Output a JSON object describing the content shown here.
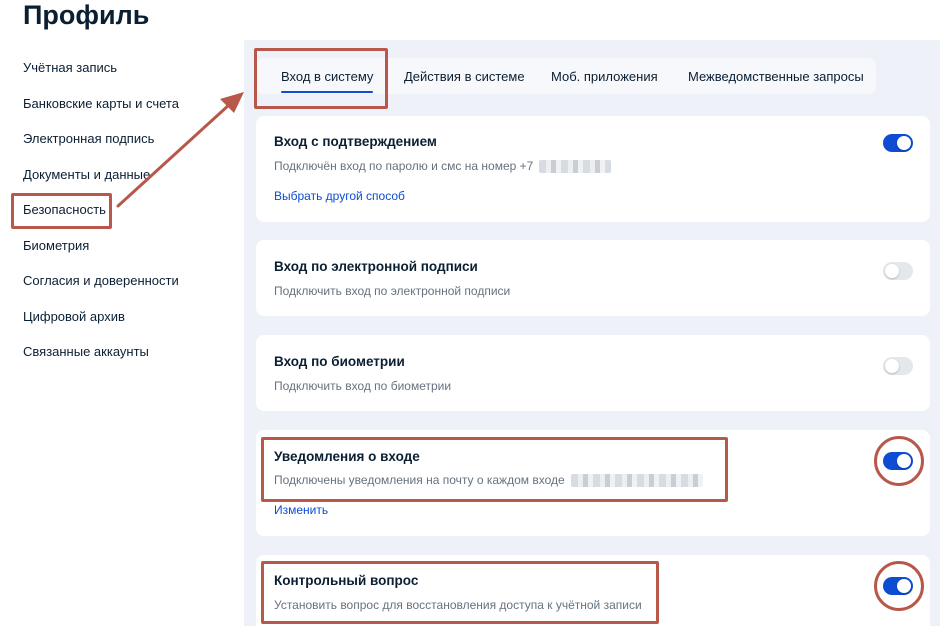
{
  "page": {
    "title": "Профиль"
  },
  "sidebar": {
    "items": [
      {
        "label": "Учётная запись"
      },
      {
        "label": "Банковские карты и счета"
      },
      {
        "label": "Электронная подпись"
      },
      {
        "label": "Документы и данные"
      },
      {
        "label": "Безопасность",
        "selected": true
      },
      {
        "label": "Биометрия"
      },
      {
        "label": "Согласия и доверенности"
      },
      {
        "label": "Цифровой архив"
      },
      {
        "label": "Связанные аккаунты"
      }
    ]
  },
  "tabs": [
    {
      "label": "Вход в систему",
      "active": true
    },
    {
      "label": "Действия в системе"
    },
    {
      "label": "Моб. приложения"
    },
    {
      "label": "Межведомственные запросы"
    }
  ],
  "cards": {
    "confirm_login": {
      "title": "Вход с подтверждением",
      "desc": "Подключён вход по паролю и смс на номер +7",
      "link": "Выбрать другой способ",
      "enabled": true
    },
    "esign_login": {
      "title": "Вход по электронной подписи",
      "desc": "Подключить вход по электронной подписи",
      "enabled": false
    },
    "biometry_login": {
      "title": "Вход по биометрии",
      "desc": "Подключить вход по биометрии",
      "enabled": false
    },
    "login_notifications": {
      "title": "Уведомления о входе",
      "desc": "Подключены уведомления на почту о каждом входе",
      "link": "Изменить",
      "enabled": true
    },
    "security_question": {
      "title": "Контрольный вопрос",
      "desc": "Установить вопрос для восстановления доступа к учётной записи",
      "enabled": true
    }
  },
  "colors": {
    "accent": "#0d4cd3",
    "annotation": "#b8584a",
    "background": "#eef1f7"
  }
}
